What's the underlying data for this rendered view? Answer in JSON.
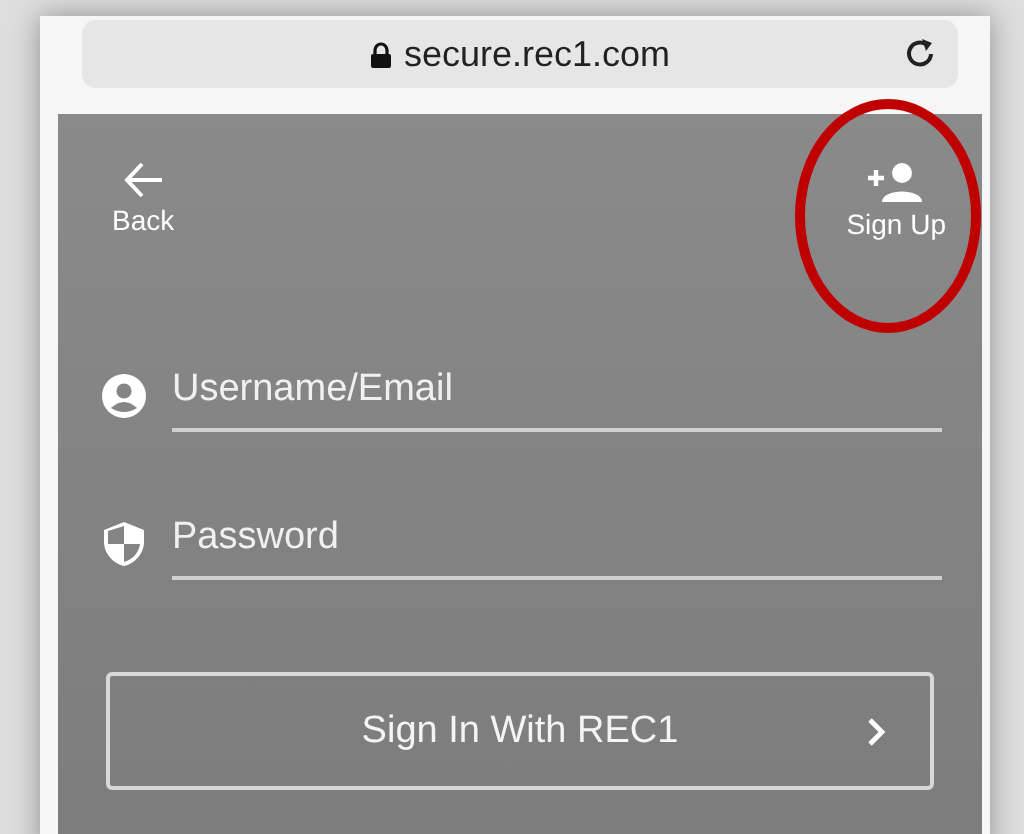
{
  "address_bar": {
    "url": "secure.rec1.com"
  },
  "header": {
    "back": {
      "label": "Back"
    },
    "sign_up": {
      "label": "Sign Up"
    }
  },
  "fields": [
    {
      "kind": "user",
      "placeholder": "Username/Email"
    },
    {
      "kind": "password",
      "placeholder": "Password"
    }
  ],
  "submit": {
    "label": "Sign In With REC1"
  },
  "annotation": {
    "kind": "ellipse"
  }
}
